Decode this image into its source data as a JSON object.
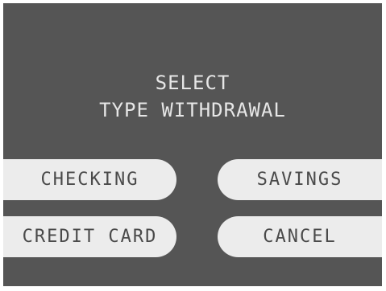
{
  "screen": {
    "prompt_line1": "SELECT",
    "prompt_line2": "TYPE WITHDRAWAL"
  },
  "options": {
    "checking": "CHECKING",
    "savings": "SAVINGS",
    "credit_card": "CREDIT CARD",
    "cancel": "CANCEL"
  },
  "colors": {
    "screen_background": "#555555",
    "prompt_text": "#e6e6e6",
    "button_background": "#ececec",
    "button_text": "#4a4a4a"
  }
}
